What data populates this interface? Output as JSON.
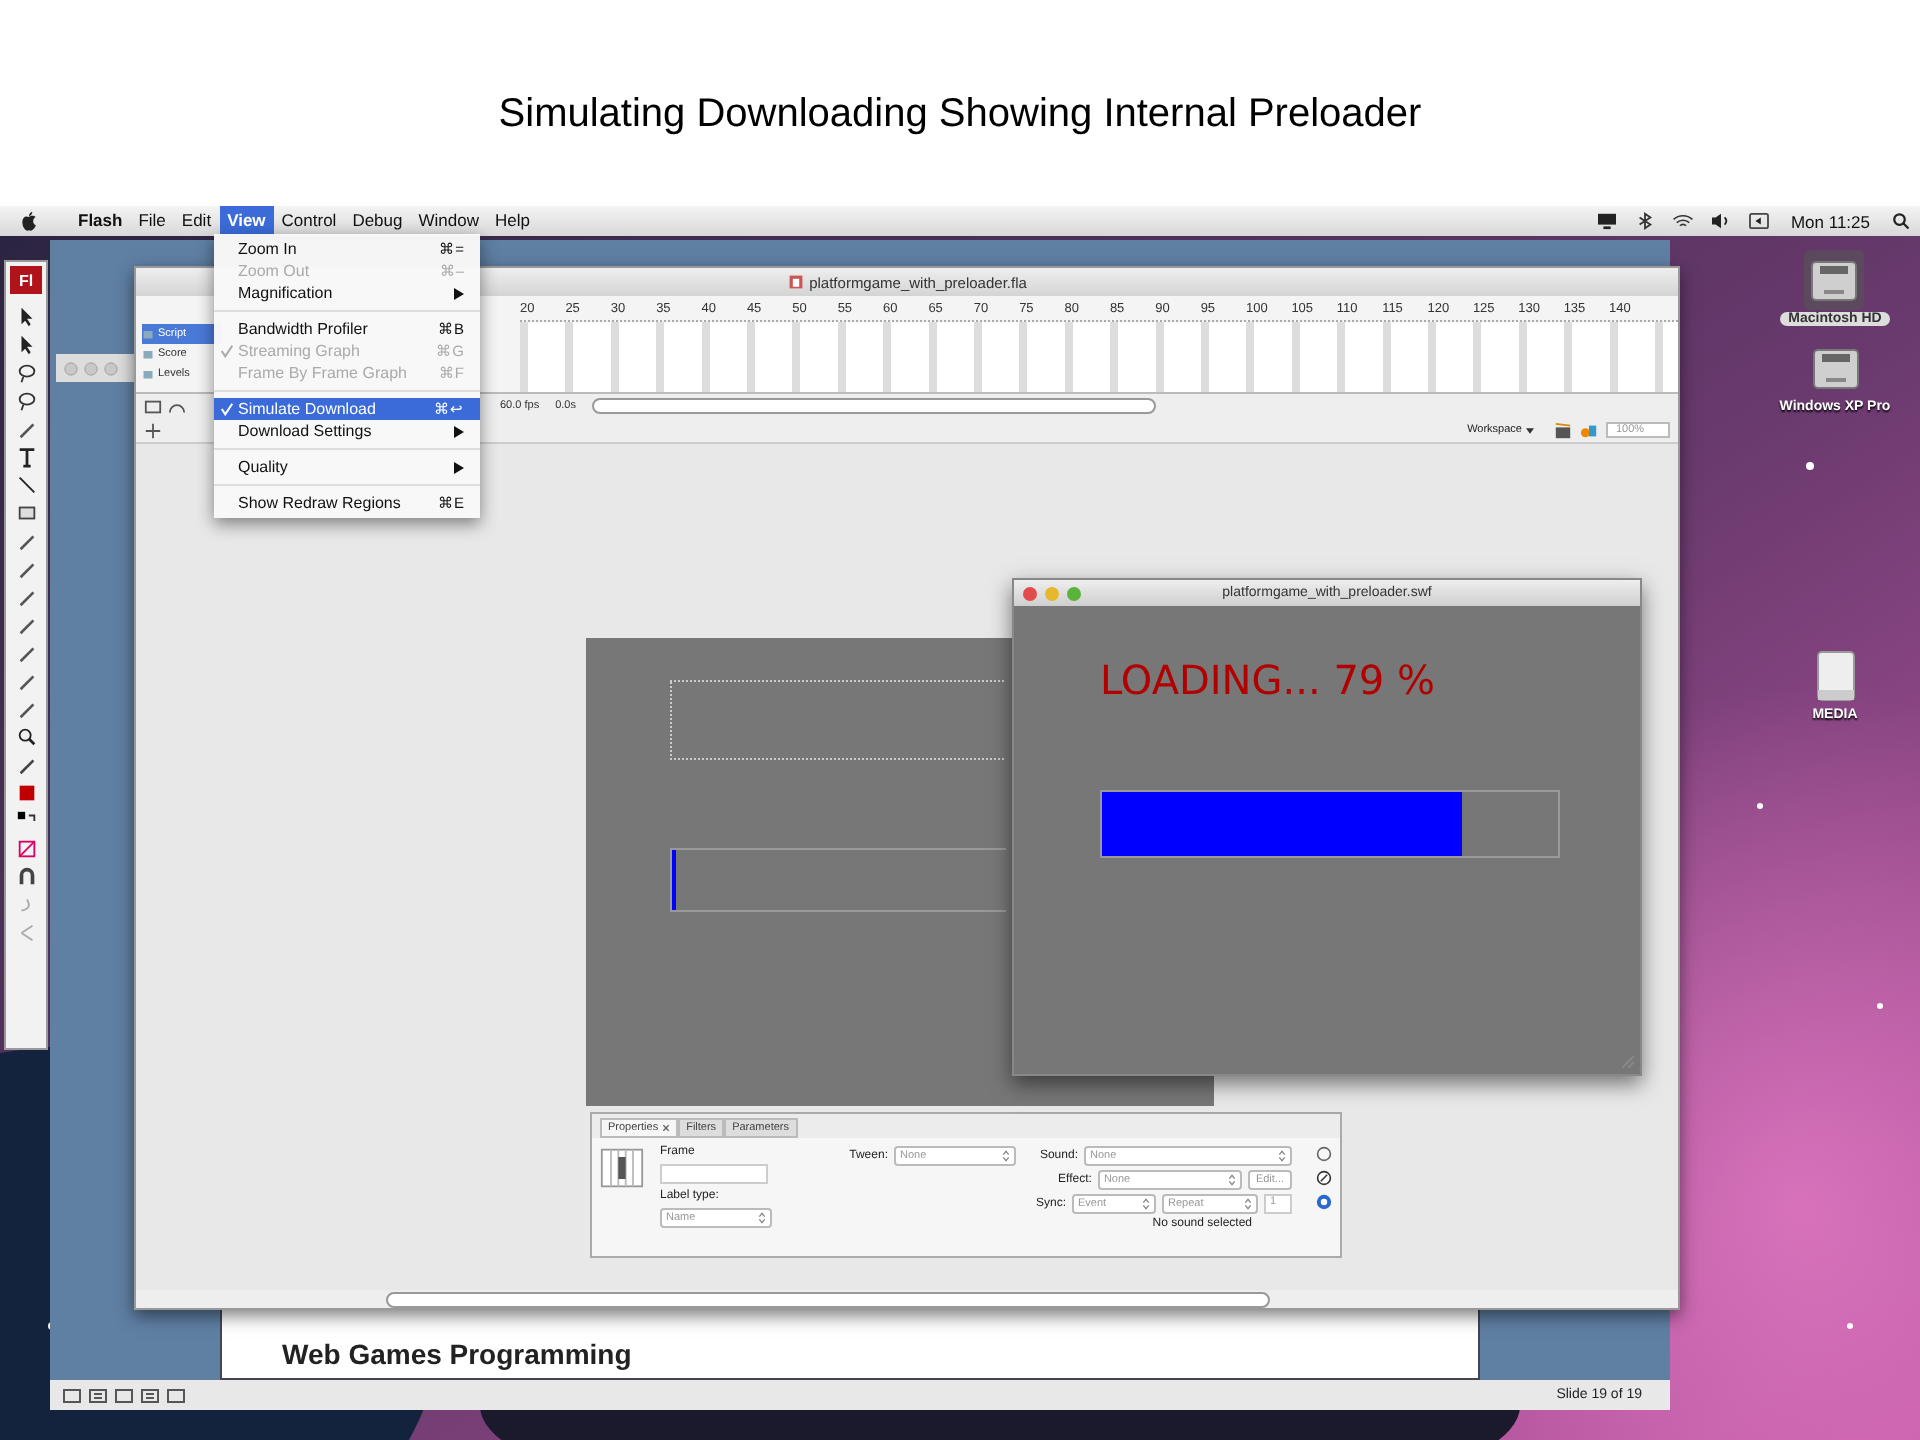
{
  "slide": {
    "title": "Simulating Downloading Showing Internal Preloader",
    "footer_text": "Web Games Programming",
    "status": "Slide 19 of 19"
  },
  "menubar": {
    "items": [
      {
        "label": "Flash",
        "selected": false
      },
      {
        "label": "File",
        "selected": false
      },
      {
        "label": "Edit",
        "selected": false
      },
      {
        "label": "View",
        "selected": true
      },
      {
        "label": "Control",
        "selected": false
      },
      {
        "label": "Debug",
        "selected": false
      },
      {
        "label": "Window",
        "selected": false
      },
      {
        "label": "Help",
        "selected": false
      }
    ],
    "clock": "Mon 11:25"
  },
  "view_menu": {
    "items": [
      {
        "kind": "item",
        "label": "Zoom In",
        "shortcut": "⌘=",
        "disabled": false,
        "checked": false,
        "selected": false,
        "submenu": false
      },
      {
        "kind": "item",
        "label": "Zoom Out",
        "shortcut": "⌘–",
        "disabled": true,
        "checked": false,
        "selected": false,
        "submenu": false
      },
      {
        "kind": "item",
        "label": "Magnification",
        "disabled": false,
        "checked": false,
        "selected": false,
        "submenu": true
      },
      {
        "kind": "separator"
      },
      {
        "kind": "item",
        "label": "Bandwidth Profiler",
        "shortcut": "⌘B",
        "disabled": false,
        "checked": false,
        "selected": false,
        "submenu": false
      },
      {
        "kind": "item",
        "label": "Streaming Graph",
        "shortcut": "⌘G",
        "disabled": true,
        "checked": true,
        "selected": false,
        "submenu": false
      },
      {
        "kind": "item",
        "label": "Frame By Frame Graph",
        "shortcut": "⌘F",
        "disabled": true,
        "checked": false,
        "selected": false,
        "submenu": false
      },
      {
        "kind": "separator"
      },
      {
        "kind": "item",
        "label": "Simulate Download",
        "shortcut": "⌘↩",
        "disabled": false,
        "checked": true,
        "selected": true,
        "submenu": false
      },
      {
        "kind": "item",
        "label": "Download Settings",
        "disabled": false,
        "checked": false,
        "selected": false,
        "submenu": true
      },
      {
        "kind": "separator"
      },
      {
        "kind": "item",
        "label": "Quality",
        "disabled": false,
        "checked": false,
        "selected": false,
        "submenu": true
      },
      {
        "kind": "separator"
      },
      {
        "kind": "item",
        "label": "Show Redraw Regions",
        "shortcut": "⌘E",
        "disabled": false,
        "checked": false,
        "selected": false,
        "submenu": false
      }
    ]
  },
  "tools_panel": {
    "logo": "Fl"
  },
  "flash_window": {
    "title": "platformgame_with_preloader.fla",
    "layers": [
      {
        "name": "Script",
        "selected": true
      },
      {
        "name": "Score",
        "selected": false
      },
      {
        "name": "Levels",
        "selected": false
      }
    ],
    "frame_numbers": [
      "20",
      "25",
      "30",
      "35",
      "40",
      "45",
      "50",
      "55",
      "60",
      "65",
      "70",
      "75",
      "80",
      "85",
      "90",
      "95",
      "100",
      "105",
      "110",
      "115",
      "120",
      "125",
      "130",
      "135",
      "140"
    ],
    "fps": "60.0 fps",
    "elapsed": "0.0s",
    "workspace": "Workspace",
    "zoom": "100%",
    "stage_bar": {
      "level": 0.01
    }
  },
  "properties_panel": {
    "tabs": [
      {
        "label": "Properties",
        "selected": true,
        "closable": true
      },
      {
        "label": "Filters",
        "selected": false,
        "closable": false
      },
      {
        "label": "Parameters",
        "selected": false,
        "closable": false
      }
    ],
    "frame_label": "Frame",
    "label_type_label": "Label type:",
    "label_type": {
      "value": "Name",
      "disabled": true
    },
    "tween_label": "Tween:",
    "tween": {
      "value": "None",
      "disabled": true
    },
    "sound_label": "Sound:",
    "sound": {
      "value": "None",
      "disabled": true
    },
    "effect_label": "Effect:",
    "effect": {
      "value": "None",
      "disabled": true
    },
    "edit_button": {
      "label": "Edit...",
      "disabled": true
    },
    "sync_label": "Sync:",
    "sync": {
      "value": "Event",
      "disabled": true
    },
    "repeat": {
      "value": "Repeat",
      "disabled": true
    },
    "repeat_count": "1",
    "status": "No sound selected"
  },
  "swf_window": {
    "title": "platformgame_with_preloader.swf",
    "loading_text": "LOADING... 79 %",
    "progress": {
      "level": 0.79
    }
  },
  "desktop_icons": [
    {
      "label": "Macintosh HD",
      "kind": "disk",
      "selected": true
    },
    {
      "label": "Windows XP Pro",
      "kind": "disk",
      "selected": false
    },
    {
      "label": "MEDIA",
      "kind": "drive",
      "selected": false
    }
  ]
}
